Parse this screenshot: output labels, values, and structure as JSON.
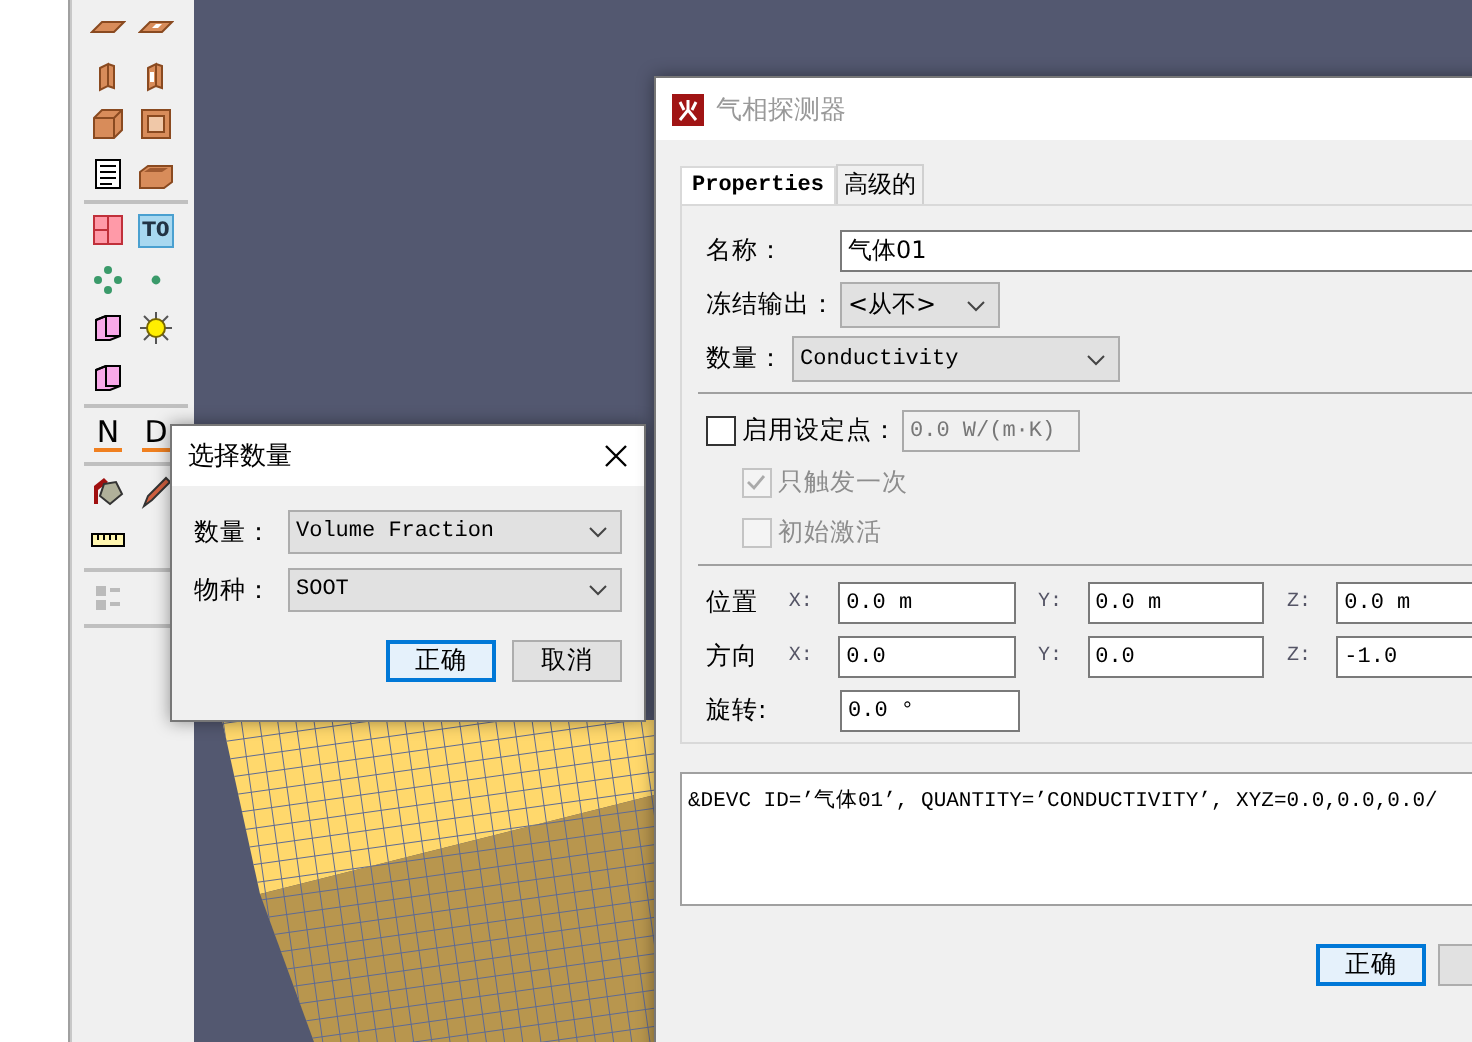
{
  "toolbar": {
    "groups": [
      [
        {
          "kind": "slab"
        },
        {
          "kind": "slab-hole"
        },
        {
          "kind": "wall"
        },
        {
          "kind": "wall-hole"
        },
        {
          "kind": "block"
        },
        {
          "kind": "block-hollow"
        },
        {
          "kind": "list"
        },
        {
          "kind": "box-open"
        }
      ],
      [
        {
          "kind": "vent"
        },
        {
          "kind": "label",
          "text": "T0"
        },
        {
          "kind": "particles"
        },
        {
          "kind": "dot"
        },
        {
          "kind": "panel"
        },
        {
          "kind": "sun"
        },
        {
          "kind": "panel"
        }
      ],
      [
        {
          "kind": "letter",
          "text": "N"
        },
        {
          "kind": "letter",
          "text": "D"
        }
      ],
      [
        {
          "kind": "paint"
        },
        {
          "kind": "pencil"
        },
        {
          "kind": "ruler"
        }
      ],
      [
        {
          "kind": "checklist"
        }
      ]
    ]
  },
  "select_dialog": {
    "title": "选择数量",
    "fields": [
      {
        "label": "数量：",
        "value": "Volume Fraction"
      },
      {
        "label": "物种：",
        "value": "SOOT"
      }
    ],
    "buttons": [
      {
        "label": "正确",
        "default": true
      },
      {
        "label": "取消",
        "default": false
      }
    ]
  },
  "device_dialog": {
    "title": "气相探测器",
    "tabs": [
      {
        "label": "Properties",
        "selected": true
      },
      {
        "label": "高级的",
        "selected": false
      }
    ],
    "name": {
      "label": "名称：",
      "value": "气体01"
    },
    "freeze_output": {
      "label": "冻结输出：",
      "value": "<从不>"
    },
    "quantity": {
      "label": "数量：",
      "value": "Conductivity"
    },
    "setpoint": {
      "label": "启用设定点：",
      "checked": false,
      "value": "0.0 W/(m·K)"
    },
    "options": [
      {
        "label": "只触发一次",
        "checked": true,
        "disabled": true
      },
      {
        "label": "初始激活",
        "checked": false,
        "disabled": true
      }
    ],
    "vectors": [
      {
        "label": "位置",
        "fields": [
          {
            "axis": "X:",
            "value": "0.0 m"
          },
          {
            "axis": "Y:",
            "value": "0.0 m"
          },
          {
            "axis": "Z:",
            "value": "0.0 m"
          }
        ]
      },
      {
        "label": "方向",
        "fields": [
          {
            "axis": "X:",
            "value": "0.0"
          },
          {
            "axis": "Y:",
            "value": "0.0"
          },
          {
            "axis": "Z:",
            "value": "-1.0"
          }
        ]
      }
    ],
    "rotation": {
      "label": "旋转:",
      "value": "0.0 °"
    },
    "preview": "&DEVC ID=’气体01’, QUANTITY=’CONDUCTIVITY’, XYZ=0.0,0.0,0.0/",
    "buttons": [
      {
        "label": "正确",
        "default": true
      }
    ]
  }
}
